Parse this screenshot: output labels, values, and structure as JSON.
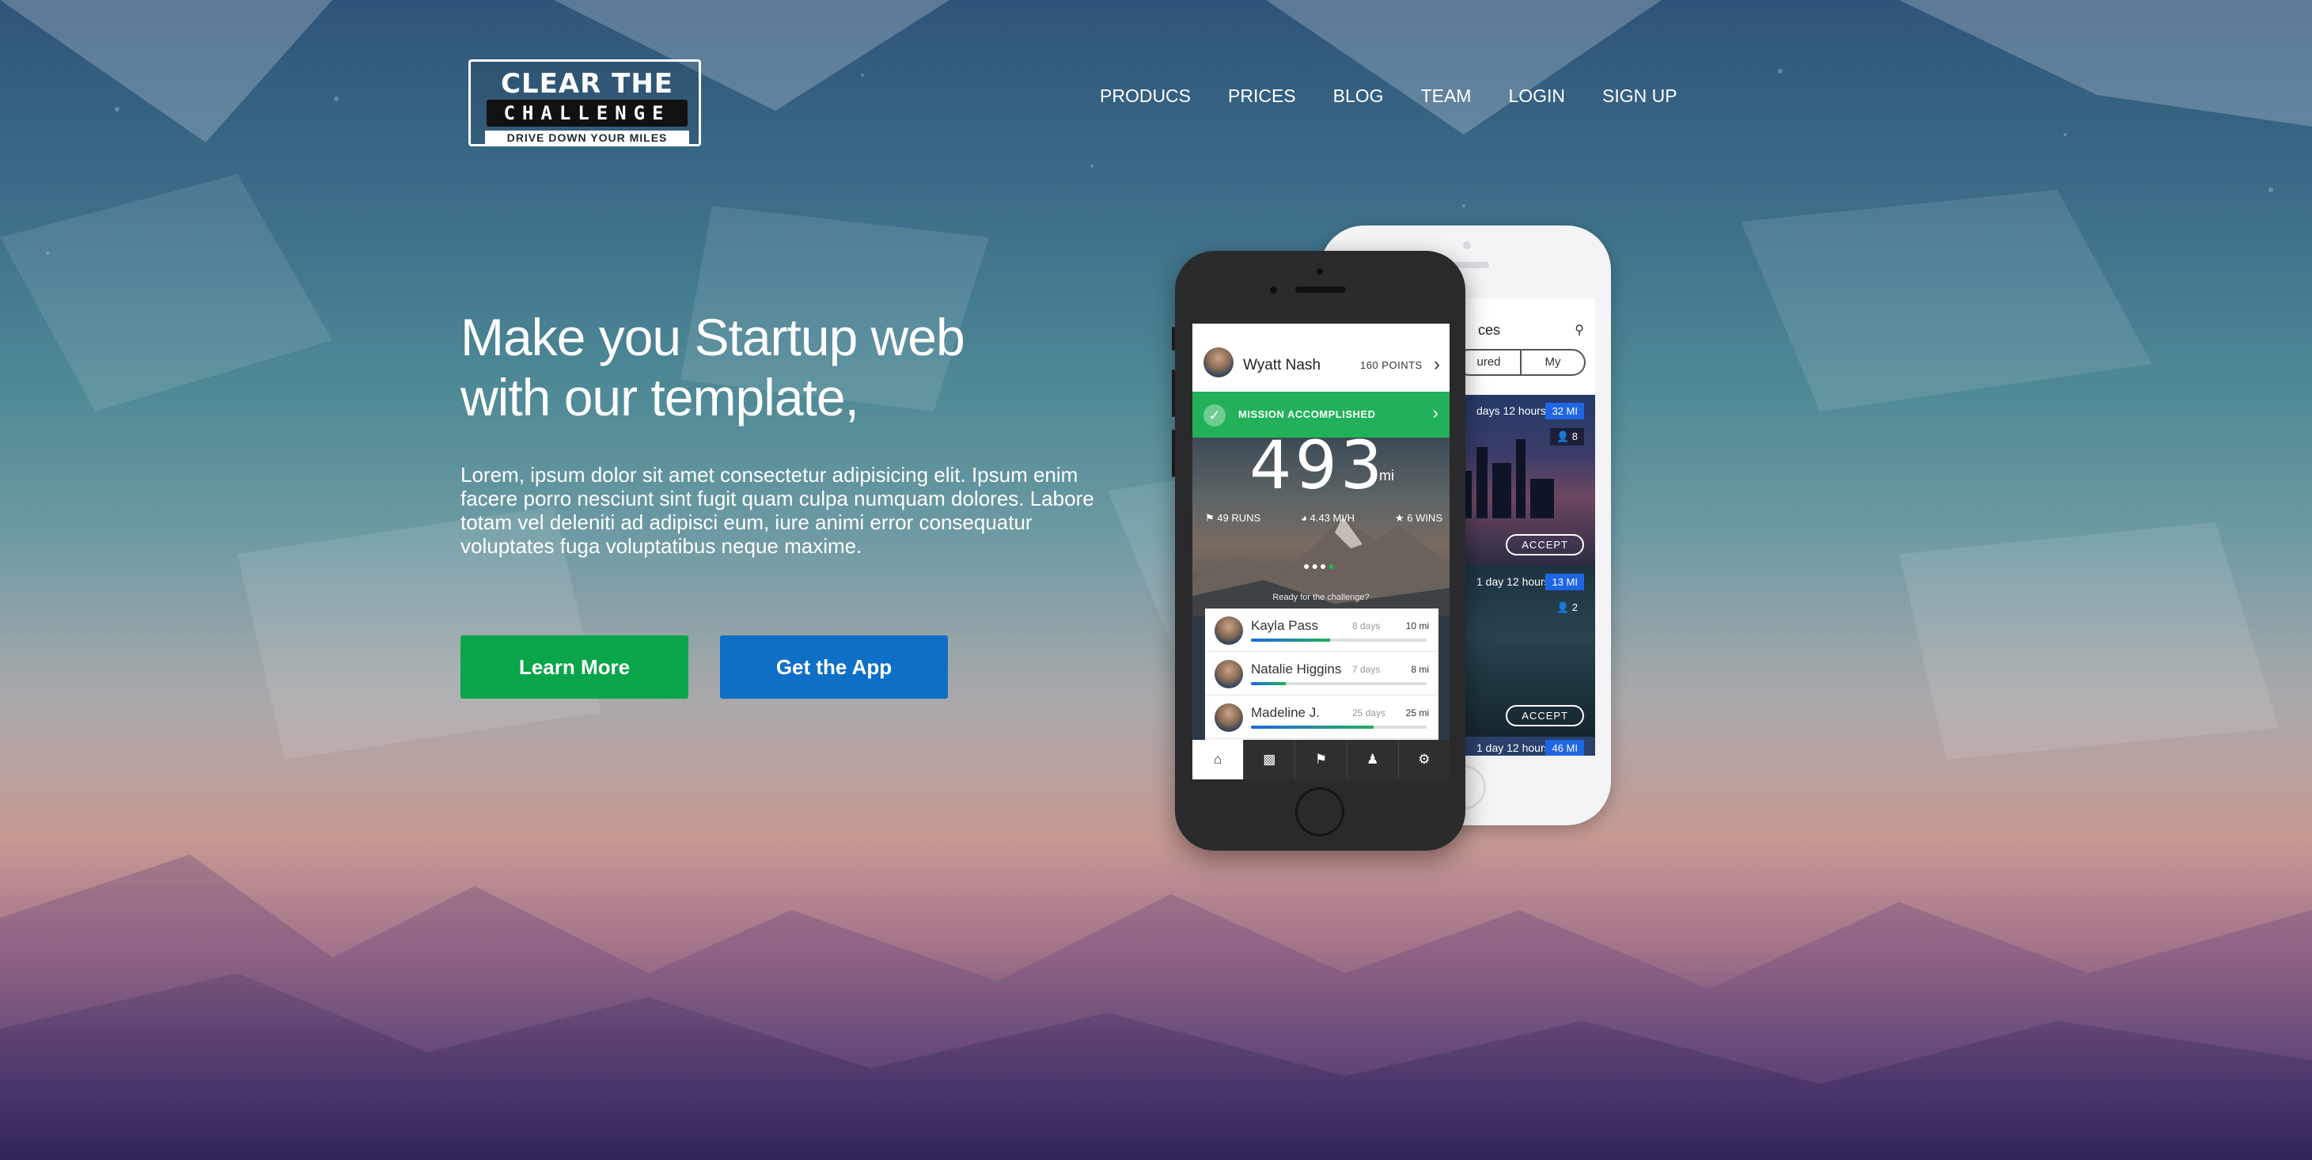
{
  "brand": {
    "line1": "CLEAR THE AIR",
    "line2": "CHALLENGE",
    "tagline": "DRIVE DOWN YOUR MILES"
  },
  "nav": {
    "items": [
      "PRODUCS",
      "PRICES",
      "BLOG",
      "TEAM",
      "LOGIN",
      "SIGN UP"
    ]
  },
  "hero": {
    "headline_line1": "Make you Startup web",
    "headline_line2": "with our template,",
    "lead": "Lorem, ipsum dolor sit amet consectetur adipisicing elit. Ipsum enim facere porro nesciunt sint fugit quam culpa numquam dolores. Labore totam vel deleniti ad adipisci eum, iure animi error consequatur voluptates fuga voluptatibus neque maxime.",
    "btn_primary": "Learn More",
    "btn_secondary": "Get the App"
  },
  "colors": {
    "primary_button": "#0aa54a",
    "secondary_button": "#0f6fc6",
    "success_banner": "#22b15a",
    "badge_blue": "#1f66e5"
  },
  "phone_front": {
    "user_name": "Wyatt Nash",
    "points": "160 POINTS",
    "banner": "MISSION ACCOMPLISHED",
    "big_value": "493",
    "big_unit": "mi",
    "stats": {
      "runs": "49 RUNS",
      "speed": "4.43 MI/H",
      "wins": "6 WINS"
    },
    "ready_text": "Ready for the challenge?",
    "leaderboard": [
      {
        "name": "Kayla Pass",
        "days": "8 days",
        "miles": "10 mi",
        "progress": 0.45
      },
      {
        "name": "Natalie Higgins",
        "days": "7 days",
        "miles": "8 mi",
        "progress": 0.2
      },
      {
        "name": "Madeline J.",
        "days": "25 days",
        "miles": "25 mi",
        "progress": 0.7
      }
    ],
    "tabs": [
      "home-icon",
      "stats-icon",
      "flag-icon",
      "person-icon",
      "settings-icon"
    ]
  },
  "phone_back": {
    "title_fragment": "ces",
    "segments": [
      "ured",
      "My"
    ],
    "cards": [
      {
        "time": "days 12 hours",
        "miles": "32 MI",
        "people": "8",
        "action": "ACCEPT"
      },
      {
        "time": "1 day 12 hours",
        "miles": "13 MI",
        "people": "2",
        "action": "ACCEPT"
      },
      {
        "time": "1 day 12 hours",
        "miles": "46 MI"
      }
    ]
  }
}
